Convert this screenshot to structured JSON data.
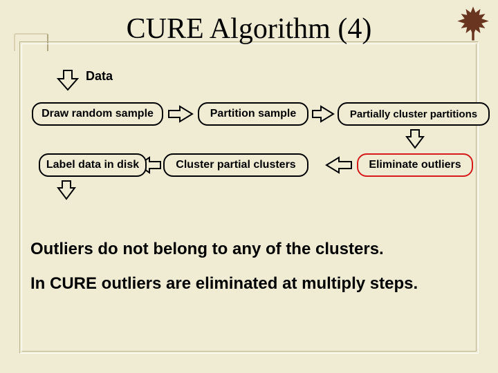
{
  "title": "CURE Algorithm (4)",
  "data_label": "Data",
  "nodes": {
    "draw": "Draw random sample",
    "partition": "Partition sample",
    "partial_cluster": "Partially cluster partitions",
    "label_disk": "Label data in disk",
    "cluster_partial": "Cluster partial clusters",
    "eliminate": "Eliminate outliers"
  },
  "body": {
    "line1": "Outliers do not belong to any of the clusters.",
    "line2": "In CURE outliers are eliminated at multiply steps."
  },
  "icons": {
    "leaf": "maple-leaf-icon",
    "tab": "notebook-tab-icon"
  }
}
